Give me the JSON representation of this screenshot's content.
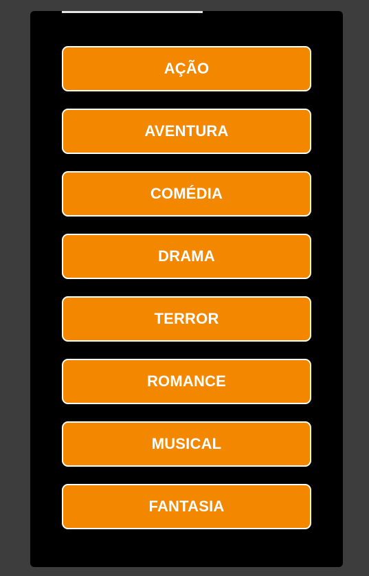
{
  "colors": {
    "page_background": "#3d3d3d",
    "panel_background": "#000000",
    "button_fill": "#f38700",
    "button_border": "#ffffff",
    "button_text": "#ffffff"
  },
  "genres": [
    {
      "label": "AÇÃO"
    },
    {
      "label": "AVENTURA"
    },
    {
      "label": "COMÉDIA"
    },
    {
      "label": "DRAMA"
    },
    {
      "label": "TERROR"
    },
    {
      "label": "ROMANCE"
    },
    {
      "label": "MUSICAL"
    },
    {
      "label": "FANTASIA"
    }
  ]
}
